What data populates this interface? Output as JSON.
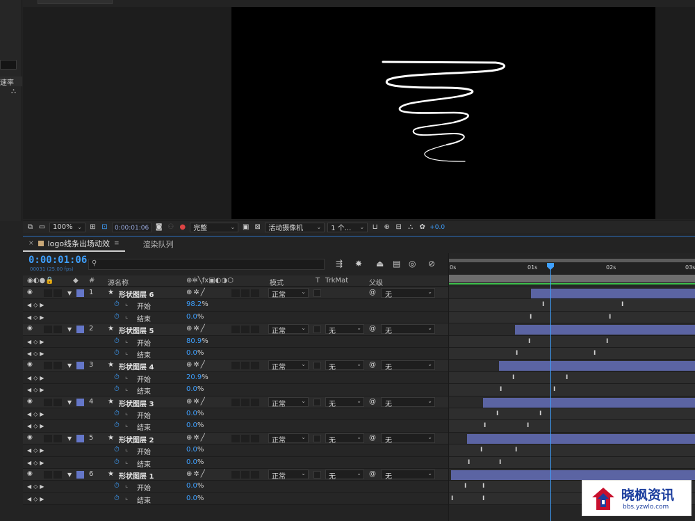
{
  "left_panel": {
    "rate_label": "速率",
    "tree_icon": "hierarchy-icon"
  },
  "viewer_toolbar": {
    "zoom": "100%",
    "timecode": "0:00:01:06",
    "resolution": "完整",
    "camera": "活动摄像机",
    "views": "1 个...",
    "exposure": "+0.0"
  },
  "timeline": {
    "tabs": [
      {
        "label": "logo线条出场动效"
      },
      {
        "label": "渲染队列"
      }
    ],
    "timecode": "0:00:01:06",
    "frames": "00031 (25.00 fps)",
    "search_placeholder": "",
    "columns": {
      "hash": "#",
      "source_name": "源名称",
      "mode": "模式",
      "t": "T",
      "trkmat": "TrkMat",
      "parent": "父级"
    },
    "ruler": [
      "0s",
      "01s",
      "02s",
      "03s"
    ],
    "layers": [
      {
        "num": "1",
        "name": "形状图层 6",
        "mode": "正常",
        "trkmat": "",
        "parent": "无",
        "props": [
          {
            "name": "开始",
            "value": "98.2",
            "unit": "%"
          },
          {
            "name": "结束",
            "value": "0.0",
            "unit": "%"
          }
        ]
      },
      {
        "num": "2",
        "name": "形状图层 5",
        "mode": "正常",
        "trkmat": "无",
        "parent": "无",
        "props": [
          {
            "name": "开始",
            "value": "80.9",
            "unit": "%"
          },
          {
            "name": "结束",
            "value": "0.0",
            "unit": "%"
          }
        ]
      },
      {
        "num": "3",
        "name": "形状图层 4",
        "mode": "正常",
        "trkmat": "无",
        "parent": "无",
        "props": [
          {
            "name": "开始",
            "value": "20.9",
            "unit": "%"
          },
          {
            "name": "结束",
            "value": "0.0",
            "unit": "%"
          }
        ]
      },
      {
        "num": "4",
        "name": "形状图层 3",
        "mode": "正常",
        "trkmat": "无",
        "parent": "无",
        "props": [
          {
            "name": "开始",
            "value": "0.0",
            "unit": "%"
          },
          {
            "name": "结束",
            "value": "0.0",
            "unit": "%"
          }
        ]
      },
      {
        "num": "5",
        "name": "形状图层 2",
        "mode": "正常",
        "trkmat": "无",
        "parent": "无",
        "props": [
          {
            "name": "开始",
            "value": "0.0",
            "unit": "%"
          },
          {
            "name": "结束",
            "value": "0.0",
            "unit": "%"
          }
        ]
      },
      {
        "num": "6",
        "name": "形状图层 1",
        "mode": "正常",
        "trkmat": "无",
        "parent": "无",
        "props": [
          {
            "name": "开始",
            "value": "0.0",
            "unit": "%"
          },
          {
            "name": "结束",
            "value": "0.0",
            "unit": "%"
          }
        ]
      }
    ]
  },
  "watermark": {
    "name": "晓枫资讯",
    "url": "bbs.yzwlo.com"
  },
  "colors": {
    "accent": "#3ea0ff",
    "layer_bar": "#5b64a3",
    "label": "#6577c9",
    "work_area_green": "#3bbf4a"
  }
}
